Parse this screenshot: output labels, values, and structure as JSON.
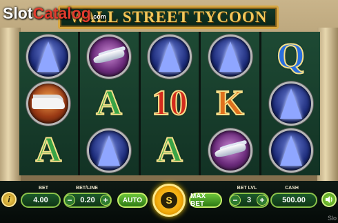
{
  "watermark": {
    "slot": "Slot",
    "catalog": "Catalog",
    "com": ".com",
    "corner": "Slo"
  },
  "game": {
    "title": "WALL STREET TYCOON"
  },
  "reels": [
    [
      "tower",
      "yacht",
      "A-green"
    ],
    [
      "jet",
      "A-green",
      "tower"
    ],
    [
      "tower",
      "10-red",
      "A-green"
    ],
    [
      "tower",
      "K-orange",
      "jet"
    ],
    [
      "Q-blue",
      "tower",
      "tower"
    ]
  ],
  "symbol_letters": {
    "A-green": "A",
    "10-red": "10",
    "K-orange": "K",
    "Q-blue": "Q"
  },
  "controls": {
    "info_icon": "i",
    "bet": {
      "label": "BET",
      "value": "4.00"
    },
    "bet_line": {
      "label": "BET/LINE",
      "value": "0.20",
      "minus": "−",
      "plus": "+"
    },
    "auto_label": "AUTO",
    "spin_label": "S",
    "max_bet_label": "MAX BET",
    "bet_level": {
      "label": "BET LVL",
      "value": "3",
      "minus": "−",
      "plus": "+"
    },
    "cash": {
      "label": "CASH",
      "value": "500.00"
    },
    "sound_icon": "speaker-icon"
  }
}
